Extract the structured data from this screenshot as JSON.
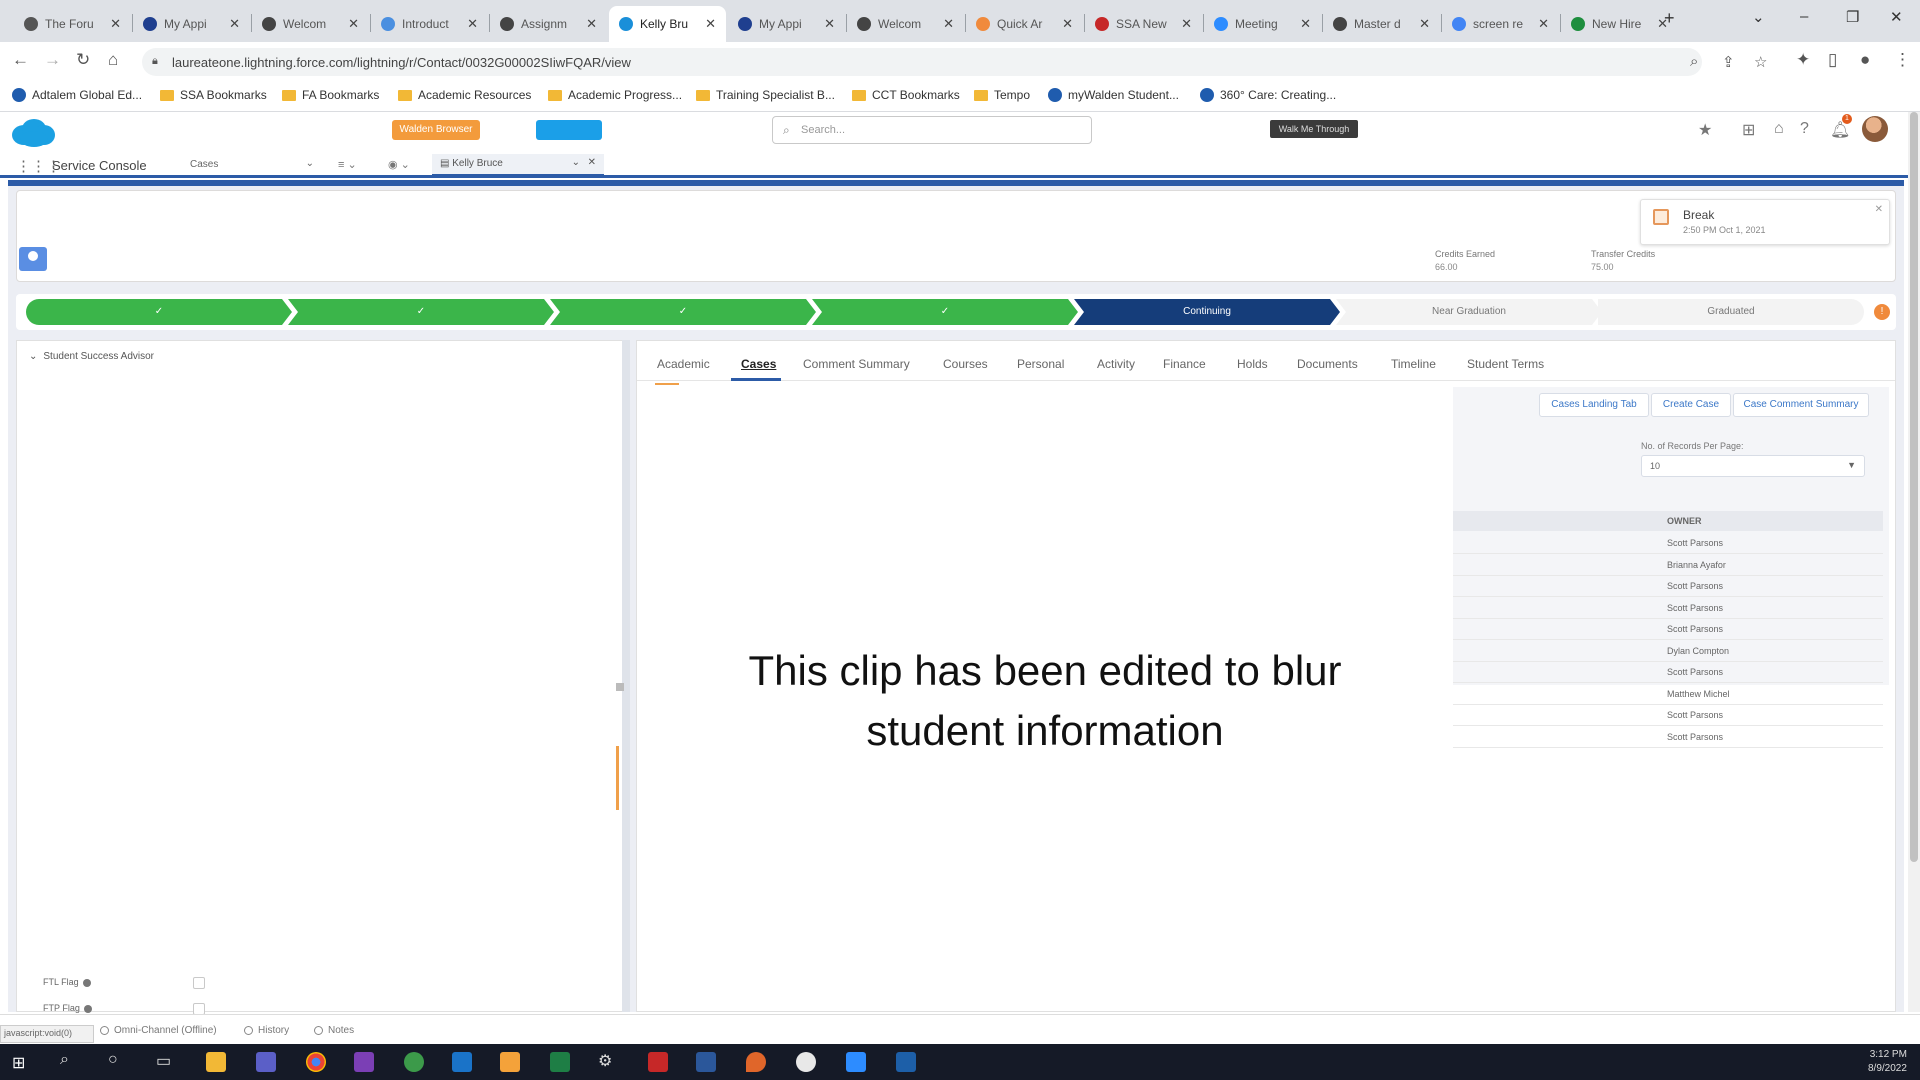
{
  "browser": {
    "tabs": [
      {
        "title": "The Foru",
        "favicon": "salesforce-icon",
        "color": "#555555",
        "active": false
      },
      {
        "title": "My Appi",
        "favicon": "circle-icon",
        "color": "#1f3f8f",
        "active": false
      },
      {
        "title": "Welcom",
        "favicon": "globe-icon",
        "color": "#444444",
        "active": false
      },
      {
        "title": "Introduct",
        "favicon": "circle-icon",
        "color": "#4a8fe0",
        "active": false
      },
      {
        "title": "Assignm",
        "favicon": "globe-icon",
        "color": "#444444",
        "active": false
      },
      {
        "title": "Kelly Bru",
        "favicon": "cloud-icon",
        "color": "#1a8fd9",
        "active": true
      },
      {
        "title": "My Appi",
        "favicon": "circle-icon",
        "color": "#1f3f8f",
        "active": false
      },
      {
        "title": "Welcom",
        "favicon": "globe-icon",
        "color": "#444444",
        "active": false
      },
      {
        "title": "Quick Ar",
        "favicon": "app-icon",
        "color": "#f08a3c",
        "active": false
      },
      {
        "title": "SSA New",
        "favicon": "pdf-icon",
        "color": "#c62828",
        "active": false
      },
      {
        "title": "Meeting",
        "favicon": "video-icon",
        "color": "#2d8cff",
        "active": false
      },
      {
        "title": "Master d",
        "favicon": "globe-icon",
        "color": "#444444",
        "active": false
      },
      {
        "title": "screen re",
        "favicon": "google-icon",
        "color": "#4285f4",
        "active": false
      },
      {
        "title": "New Hire",
        "favicon": "sheet-icon",
        "color": "#1e8e3e",
        "active": false
      }
    ],
    "url": "laureateone.lightning.force.com/lightning/r/Contact/0032G00002SIiwFQAR/view",
    "bookmarks": [
      {
        "label": "Adtalem Global Ed...",
        "type": "site"
      },
      {
        "label": "SSA Bookmarks",
        "type": "folder"
      },
      {
        "label": "FA Bookmarks",
        "type": "folder"
      },
      {
        "label": "Academic Resources",
        "type": "folder"
      },
      {
        "label": "Academic Progress...",
        "type": "folder"
      },
      {
        "label": "Training Specialist B...",
        "type": "folder"
      },
      {
        "label": "CCT Bookmarks",
        "type": "folder"
      },
      {
        "label": "Tempo",
        "type": "folder"
      },
      {
        "label": "myWalden Student...",
        "type": "site"
      },
      {
        "label": "360° Care: Creating...",
        "type": "site"
      }
    ]
  },
  "sf_header": {
    "orange_button": "Walden Browser",
    "search_placeholder": "Search...",
    "walk_button": "Walk Me Through",
    "notification_count": "1"
  },
  "console": {
    "title": "Service Console",
    "nav_dropdown": "Cases",
    "record_tab": "Kelly Bruce"
  },
  "highlights": {
    "fields": [
      {
        "label": "Credits Earned",
        "value": "66.00"
      },
      {
        "label": "Transfer Credits",
        "value": "75.00"
      }
    ]
  },
  "break_popup": {
    "title": "Break",
    "time": "2:50 PM Oct 1, 2021"
  },
  "path": {
    "steps": [
      {
        "label": "✓",
        "state": "done"
      },
      {
        "label": "✓",
        "state": "done"
      },
      {
        "label": "✓",
        "state": "done"
      },
      {
        "label": "✓",
        "state": "done"
      },
      {
        "label": "Continuing",
        "state": "current"
      },
      {
        "label": "Near Graduation",
        "state": "todo"
      },
      {
        "label": "Graduated",
        "state": "todo"
      }
    ]
  },
  "left_panel": {
    "section_title": "Student Success Advisor",
    "flags": [
      "FTL Flag",
      "FTP Flag"
    ]
  },
  "right_panel": {
    "tabs": [
      "Academic",
      "Cases",
      "Comment Summary",
      "Courses",
      "Personal",
      "Activity",
      "Finance",
      "Holds",
      "Documents",
      "Timeline",
      "Student Terms"
    ],
    "active_tab": "Cases",
    "buttons": [
      "Cases Landing Tab",
      "Create Case",
      "Case Comment Summary"
    ],
    "records_per_page_label": "No. of Records Per Page:",
    "records_per_page_value": "10",
    "owner_header": "OWNER",
    "owners": [
      "Scott Parsons",
      "Brianna Ayafor",
      "Scott Parsons",
      "Scott Parsons",
      "Scott Parsons",
      "Dylan Compton",
      "Scott Parsons",
      "Matthew Michel",
      "Scott Parsons",
      "Scott Parsons"
    ],
    "overlay_message_line1": "This clip has been edited to blur",
    "overlay_message_line2": "student information"
  },
  "utility_bar": {
    "status_text": "javascript:void(0)",
    "items": [
      "Omni-Channel (Offline)",
      "History",
      "Notes"
    ]
  },
  "taskbar": {
    "time": "3:12 PM",
    "date": "8/9/2022"
  },
  "colors": {
    "path_done": "#3bb54a",
    "path_current": "#153d7a",
    "brand_blue": "#2c5ba7"
  }
}
